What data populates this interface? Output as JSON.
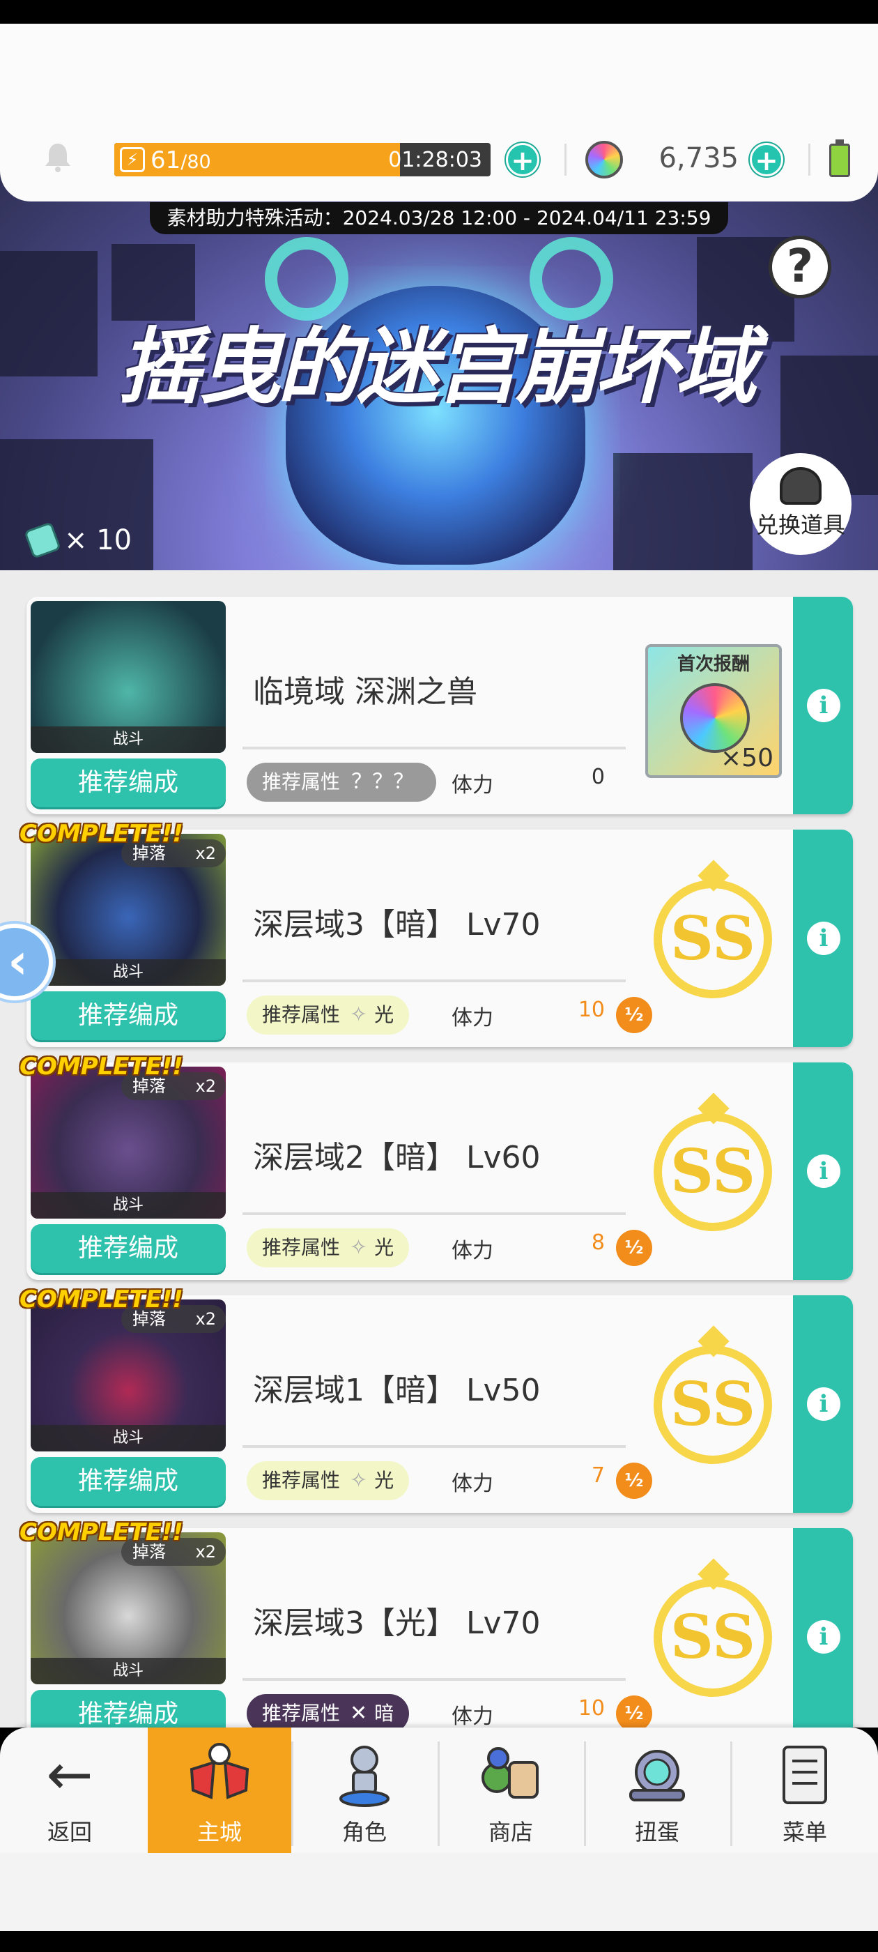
{
  "header": {
    "stamina_current": "61",
    "stamina_max": "/80",
    "stamina_fill_fraction": 0.76,
    "stamina_timer": "01:28:03",
    "gem_count": "6,735",
    "bolt_glyph": "⚡",
    "plus_glyph": "+"
  },
  "banner": {
    "event_text": "素材助力特殊活动：2024.03/28 12:00 - 2024.04/11 23:59",
    "title": "摇曳的迷宫崩坏域",
    "help_glyph": "?",
    "exchange_label": "兑换道具",
    "ticket_count": "× 10"
  },
  "labels": {
    "battle": "战斗",
    "drop": "掉落",
    "drop_mult": "x2",
    "recommend_team": "推荐编成",
    "recommend_attr": "推荐属性",
    "stamina": "体力",
    "complete": "COMPLETE!!",
    "first_reward": "首次报酬",
    "info_glyph": "i",
    "half_glyph": "½",
    "rank": "SS"
  },
  "stages": [
    {
      "name": "临境域 深渊之兽",
      "attr": "？？？",
      "stamina": "0",
      "reward_qty": "×50"
    },
    {
      "name": "深层域3【暗】 Lv70",
      "attr": "光",
      "attr_icon": "✧",
      "stamina": "10"
    },
    {
      "name": "深层域2【暗】 Lv60",
      "attr": "光",
      "attr_icon": "✧",
      "stamina": "8"
    },
    {
      "name": "深层域1【暗】 Lv50",
      "attr": "光",
      "attr_icon": "✧",
      "stamina": "7"
    },
    {
      "name": "深层域3【光】 Lv70",
      "attr": "暗",
      "attr_icon": "✕",
      "stamina": "10"
    }
  ],
  "side_arrow_glyph": "‹",
  "nav": {
    "back": "返回",
    "home": "主城",
    "characters": "角色",
    "shop": "商店",
    "gacha": "扭蛋",
    "menu": "菜单",
    "back_glyph": "←"
  },
  "colors": {
    "teal": "#2ec2ad",
    "orange": "#f5a31c",
    "gold": "#f7d64a"
  }
}
